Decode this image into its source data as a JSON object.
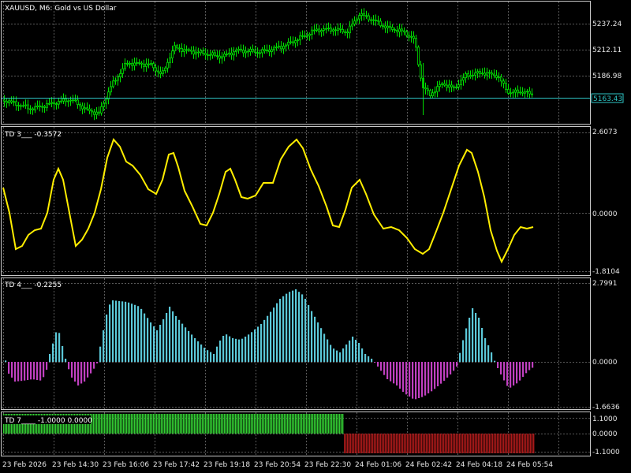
{
  "window": {
    "symbol_title": "XAUUSD, M6:  Gold vs US Dollar"
  },
  "colors": {
    "background": "#000000",
    "grid": "#5a5a5a",
    "frame": "#c8c8c8",
    "candle_up": "#00e000",
    "candle_down": "#00e000",
    "price_line": "#2ec4c4",
    "td3_line": "#ffee00",
    "td4_positive": "#5bc8d8",
    "td4_negative": "#c040c0",
    "td7_positive": "#33cc33",
    "td7_negative": "#aa1a1a"
  },
  "price_panel": {
    "current_price_label": "5163.43",
    "price_ticks": [
      "5237.24",
      "5212.11",
      "5186.98"
    ]
  },
  "indicators": {
    "td3": {
      "title": "TD 3___ -0.3572",
      "ticks": [
        "2.6073",
        "0.0000",
        "-1.8104"
      ]
    },
    "td4": {
      "title": "TD 4___ -0.2255",
      "ticks": [
        "2.7991",
        "0.0000",
        "-1.6636"
      ]
    },
    "td7": {
      "title": "TD 7____ -1.0000 0.0000",
      "ticks": [
        "1.1000",
        "0.0000",
        "-1.1000"
      ]
    }
  },
  "time_axis": {
    "labels": [
      "23 Feb 2026",
      "23 Feb 14:30",
      "23 Feb 16:06",
      "23 Feb 17:42",
      "23 Feb 19:18",
      "23 Feb 20:54",
      "23 Feb 22:30",
      "24 Feb 01:06",
      "24 Feb 02:42",
      "24 Feb 04:18",
      "24 Feb 05:54"
    ]
  }
}
